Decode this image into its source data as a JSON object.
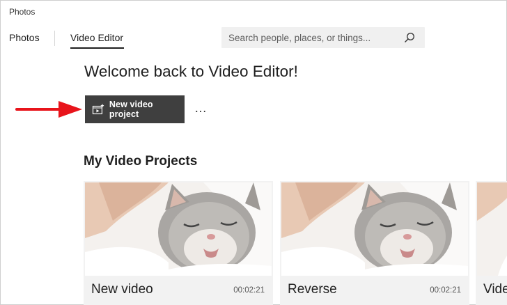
{
  "app": {
    "title": "Photos"
  },
  "nav": {
    "tabs": [
      {
        "label": "Photos"
      },
      {
        "label": "Video Editor"
      }
    ]
  },
  "search": {
    "placeholder": "Search people, places, or things..."
  },
  "welcome": {
    "heading": "Welcome back to Video Editor!"
  },
  "actions": {
    "new_project_label": "New video project",
    "more_label": "…"
  },
  "projects": {
    "section_title": "My Video Projects",
    "items": [
      {
        "title": "New video",
        "duration": "00:02:21"
      },
      {
        "title": "Reverse",
        "duration": "00:02:21"
      },
      {
        "title": "Vide"
      }
    ]
  },
  "colors": {
    "button_bg": "#3f3f3f",
    "annotation_arrow": "#e8141b"
  },
  "icons": {
    "search": "search-icon",
    "new_project": "video-project-icon",
    "arrow": "annotation-arrow-icon",
    "thumbnail": "kitten-thumbnail"
  }
}
